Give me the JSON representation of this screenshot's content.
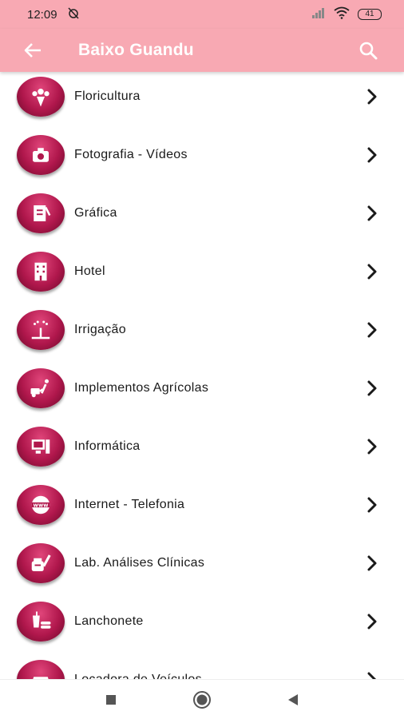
{
  "status": {
    "time": "12:09",
    "battery": "41"
  },
  "app_bar": {
    "title": "Baixo Guandu"
  },
  "categories": [
    {
      "label": "Floricultura",
      "icon": "flower-bouquet-icon"
    },
    {
      "label": "Fotografia - Vídeos",
      "icon": "camera-icon"
    },
    {
      "label": "Gráfica",
      "icon": "print-icon"
    },
    {
      "label": "Hotel",
      "icon": "hotel-building-icon"
    },
    {
      "label": "Irrigação",
      "icon": "irrigation-sprinkler-icon"
    },
    {
      "label": "Implementos Agrícolas",
      "icon": "farm-tools-icon"
    },
    {
      "label": "Informática",
      "icon": "computer-icon"
    },
    {
      "label": "Internet - Telefonia",
      "icon": "www-globe-icon"
    },
    {
      "label": "Lab. Análises Clínicas",
      "icon": "lab-syringe-icon"
    },
    {
      "label": "Lanchonete",
      "icon": "snack-icon"
    },
    {
      "label": "Locadora de Veículos",
      "icon": "car-icon"
    }
  ],
  "colors": {
    "app_bar": "#f8a9b3",
    "icon_disc": "#b0174c",
    "chevron": "#1a1a1a"
  }
}
